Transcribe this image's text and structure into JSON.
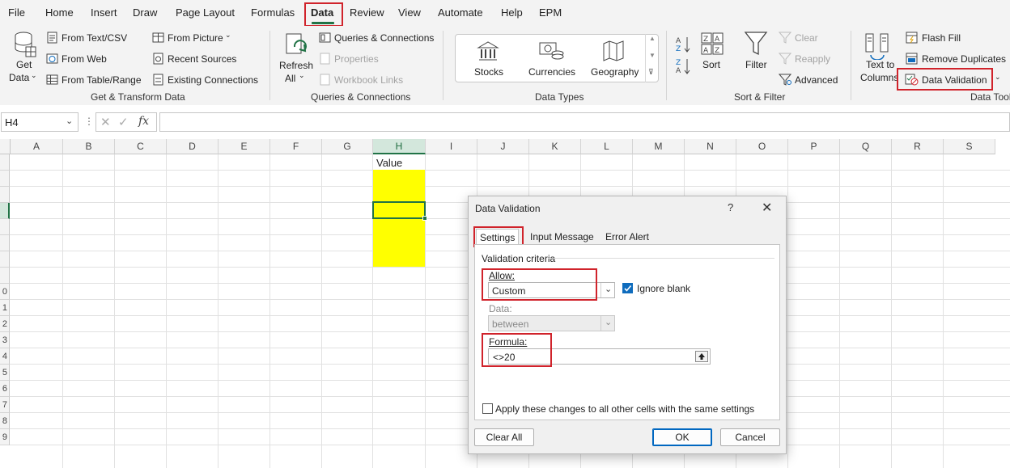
{
  "menu": {
    "items": [
      "File",
      "Home",
      "Insert",
      "Draw",
      "Page Layout",
      "Formulas",
      "Data",
      "Review",
      "View",
      "Automate",
      "Help",
      "EPM"
    ],
    "active": "Data"
  },
  "ribbon": {
    "get_data": {
      "line1": "Get",
      "line2": "Data"
    },
    "from_text_csv": "From Text/CSV",
    "from_web": "From Web",
    "from_table_range": "From Table/Range",
    "from_picture": "From Picture",
    "recent_sources": "Recent Sources",
    "existing_connections": "Existing Connections",
    "group_get_transform": "Get & Transform Data",
    "refresh": {
      "line1": "Refresh",
      "line2": "All"
    },
    "queries_connections": "Queries & Connections",
    "properties": "Properties",
    "workbook_links": "Workbook Links",
    "group_queries": "Queries & Connections",
    "stocks": "Stocks",
    "currencies": "Currencies",
    "geography": "Geography",
    "group_data_types": "Data Types",
    "sort": "Sort",
    "filter": "Filter",
    "clear": "Clear",
    "reapply": "Reapply",
    "advanced": "Advanced",
    "group_sort_filter": "Sort & Filter",
    "text_to_columns": {
      "line1": "Text to",
      "line2": "Columns"
    },
    "flash_fill": "Flash Fill",
    "remove_duplicates": "Remove Duplicates",
    "data_validation": "Data Validation",
    "group_data_tools": "Data Tool"
  },
  "formula_bar": {
    "name_box": "H4",
    "fx": "fx",
    "formula": ""
  },
  "grid": {
    "columns": [
      "A",
      "B",
      "C",
      "D",
      "E",
      "F",
      "G",
      "H",
      "I",
      "J",
      "K",
      "L",
      "M",
      "N",
      "O",
      "P",
      "Q",
      "R",
      "S"
    ],
    "selected_column": "H",
    "rows": [
      "",
      "",
      "",
      "",
      "",
      "",
      "",
      "",
      "0",
      "1",
      "2",
      "3",
      "4",
      "5",
      "6",
      "7",
      "8",
      "9"
    ],
    "header_cell": "Value"
  },
  "dialog": {
    "title": "Data Validation",
    "help": "?",
    "close": "✕",
    "tabs": [
      "Settings",
      "Input Message",
      "Error Alert"
    ],
    "active_tab": "Settings",
    "criteria_title": "Validation criteria",
    "allow_label": "Allow:",
    "allow_value": "Custom",
    "ignore_blank": "Ignore blank",
    "ignore_blank_checked": true,
    "data_label": "Data:",
    "data_value": "between",
    "formula_label": "Formula:",
    "formula_value": "<>20",
    "apply_all": "Apply these changes to all other cells with the same settings",
    "apply_all_checked": false,
    "clear_all": "Clear All",
    "ok": "OK",
    "cancel": "Cancel"
  },
  "colors": {
    "accent_green": "#217346",
    "highlight_red": "#d0232b",
    "cell_yellow": "#ffff00",
    "checkbox_blue": "#0f6cbd"
  }
}
